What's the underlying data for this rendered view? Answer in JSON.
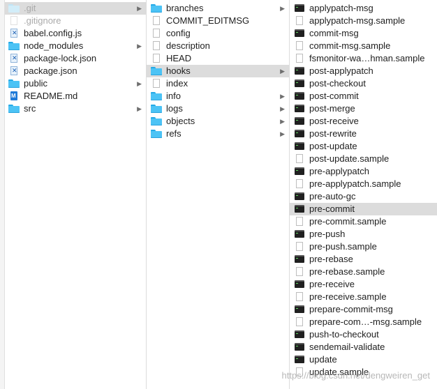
{
  "column1": {
    "items": [
      {
        "name": ".git",
        "icon": "folder-icon",
        "selected": true,
        "dim": true,
        "chevron": true
      },
      {
        "name": ".gitignore",
        "icon": "document-icon",
        "selected": false,
        "dim": true,
        "chevron": false
      },
      {
        "name": "babel.config.js",
        "icon": "js-file-icon",
        "selected": false,
        "dim": false,
        "chevron": false
      },
      {
        "name": "node_modules",
        "icon": "folder-icon",
        "selected": false,
        "dim": false,
        "chevron": true
      },
      {
        "name": "package-lock.json",
        "icon": "js-file-icon",
        "selected": false,
        "dim": false,
        "chevron": false
      },
      {
        "name": "package.json",
        "icon": "js-file-icon",
        "selected": false,
        "dim": false,
        "chevron": false
      },
      {
        "name": "public",
        "icon": "folder-icon",
        "selected": false,
        "dim": false,
        "chevron": true
      },
      {
        "name": "README.md",
        "icon": "markdown-file-icon",
        "selected": false,
        "dim": false,
        "chevron": false
      },
      {
        "name": "src",
        "icon": "folder-icon",
        "selected": false,
        "dim": false,
        "chevron": true
      }
    ]
  },
  "column2": {
    "items": [
      {
        "name": "branches",
        "icon": "folder-icon",
        "selected": false,
        "chevron": true
      },
      {
        "name": "COMMIT_EDITMSG",
        "icon": "document-icon",
        "selected": false,
        "chevron": false
      },
      {
        "name": "config",
        "icon": "document-icon",
        "selected": false,
        "chevron": false
      },
      {
        "name": "description",
        "icon": "document-icon",
        "selected": false,
        "chevron": false
      },
      {
        "name": "HEAD",
        "icon": "document-icon",
        "selected": false,
        "chevron": false
      },
      {
        "name": "hooks",
        "icon": "folder-icon",
        "selected": true,
        "chevron": true
      },
      {
        "name": "index",
        "icon": "document-icon",
        "selected": false,
        "chevron": false
      },
      {
        "name": "info",
        "icon": "folder-icon",
        "selected": false,
        "chevron": true
      },
      {
        "name": "logs",
        "icon": "folder-icon",
        "selected": false,
        "chevron": true
      },
      {
        "name": "objects",
        "icon": "folder-icon",
        "selected": false,
        "chevron": true
      },
      {
        "name": "refs",
        "icon": "folder-icon",
        "selected": false,
        "chevron": true
      }
    ]
  },
  "column3": {
    "items": [
      {
        "name": "applypatch-msg",
        "icon": "executable-icon",
        "selected": false
      },
      {
        "name": "applypatch-msg.sample",
        "icon": "document-icon",
        "selected": false
      },
      {
        "name": "commit-msg",
        "icon": "executable-icon",
        "selected": false
      },
      {
        "name": "commit-msg.sample",
        "icon": "document-icon",
        "selected": false
      },
      {
        "name": "fsmonitor-wa…hman.sample",
        "icon": "document-icon",
        "selected": false
      },
      {
        "name": "post-applypatch",
        "icon": "executable-icon",
        "selected": false
      },
      {
        "name": "post-checkout",
        "icon": "executable-icon",
        "selected": false
      },
      {
        "name": "post-commit",
        "icon": "executable-icon",
        "selected": false
      },
      {
        "name": "post-merge",
        "icon": "executable-icon",
        "selected": false
      },
      {
        "name": "post-receive",
        "icon": "executable-icon",
        "selected": false
      },
      {
        "name": "post-rewrite",
        "icon": "executable-icon",
        "selected": false
      },
      {
        "name": "post-update",
        "icon": "executable-icon",
        "selected": false
      },
      {
        "name": "post-update.sample",
        "icon": "document-icon",
        "selected": false
      },
      {
        "name": "pre-applypatch",
        "icon": "executable-icon",
        "selected": false
      },
      {
        "name": "pre-applypatch.sample",
        "icon": "document-icon",
        "selected": false
      },
      {
        "name": "pre-auto-gc",
        "icon": "executable-icon",
        "selected": false
      },
      {
        "name": "pre-commit",
        "icon": "executable-icon",
        "selected": true
      },
      {
        "name": "pre-commit.sample",
        "icon": "document-icon",
        "selected": false
      },
      {
        "name": "pre-push",
        "icon": "executable-icon",
        "selected": false
      },
      {
        "name": "pre-push.sample",
        "icon": "document-icon",
        "selected": false
      },
      {
        "name": "pre-rebase",
        "icon": "executable-icon",
        "selected": false
      },
      {
        "name": "pre-rebase.sample",
        "icon": "document-icon",
        "selected": false
      },
      {
        "name": "pre-receive",
        "icon": "executable-icon",
        "selected": false
      },
      {
        "name": "pre-receive.sample",
        "icon": "document-icon",
        "selected": false
      },
      {
        "name": "prepare-commit-msg",
        "icon": "executable-icon",
        "selected": false
      },
      {
        "name": "prepare-com…-msg.sample",
        "icon": "document-icon",
        "selected": false
      },
      {
        "name": "push-to-checkout",
        "icon": "executable-icon",
        "selected": false
      },
      {
        "name": "sendemail-validate",
        "icon": "executable-icon",
        "selected": false
      },
      {
        "name": "update",
        "icon": "executable-icon",
        "selected": false
      },
      {
        "name": "update.sample",
        "icon": "document-icon",
        "selected": false
      }
    ]
  },
  "watermark": "https://blog.csdn.net/dengweiren_get",
  "colors": {
    "selection": "#dcdcdc",
    "folder": "#4cc3f5",
    "text": "#1e1e1e",
    "dimText": "#aaaaaa"
  }
}
